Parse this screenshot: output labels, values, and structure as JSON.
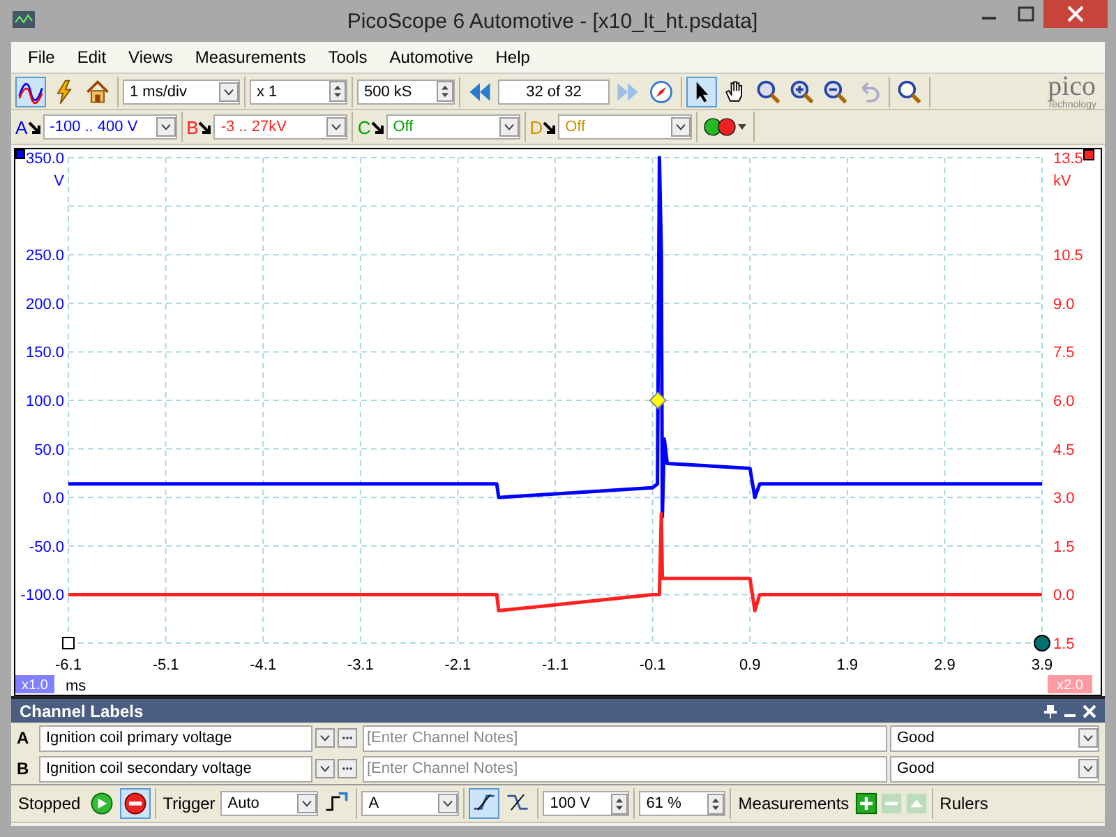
{
  "window": {
    "title": "PicoScope 6 Automotive - [x10_lt_ht.psdata]"
  },
  "menu": [
    "File",
    "Edit",
    "Views",
    "Measurements",
    "Tools",
    "Automotive",
    "Help"
  ],
  "toolbar": {
    "timebase": "1 ms/div",
    "zoom": "x 1",
    "samples": "500 kS",
    "buffer": "32 of 32",
    "logo": "pico",
    "logo_subtitle": "Technology"
  },
  "channels": [
    {
      "letter": "A",
      "range": "-100 .. 400 V",
      "color": "#0000ff"
    },
    {
      "letter": "B",
      "range": "-3 .. 27kV",
      "color": "#ff2020"
    },
    {
      "letter": "C",
      "range": "Off",
      "color": "#00a000"
    },
    {
      "letter": "D",
      "range": "Off",
      "color": "#d09000"
    }
  ],
  "chart": {
    "left_unit": "V",
    "right_unit": "kV",
    "x_unit": "ms",
    "left_scale": "x1.0",
    "right_scale": "x2.0",
    "chart_data": {
      "type": "line",
      "xlim": [
        -6.1,
        3.9
      ],
      "ylim": [
        -150,
        350
      ],
      "xticks": [
        -6.1,
        -5.1,
        -4.1,
        -3.1,
        -2.1,
        -1.1,
        -0.1,
        0.9,
        1.9,
        2.9,
        3.9
      ],
      "yticks": [
        {
          "value": 350,
          "label": "350.0"
        },
        {
          "value": 250,
          "label": "250.0"
        },
        {
          "value": 200,
          "label": "200.0"
        },
        {
          "value": 150,
          "label": "150.0"
        },
        {
          "value": 100,
          "label": "100.0"
        },
        {
          "value": 50,
          "label": "50.0"
        },
        {
          "value": 0,
          "label": "0.0"
        },
        {
          "value": -50,
          "label": "-50.0"
        },
        {
          "value": -100,
          "label": "-100.0"
        }
      ],
      "y2lim": [
        -1.5,
        13.5
      ],
      "y2ticks": [
        {
          "value": 13.5,
          "label": "13.5"
        },
        {
          "value": 10.5,
          "label": "10.5"
        },
        {
          "value": 9,
          "label": "9.0"
        },
        {
          "value": 7.5,
          "label": "7.5"
        },
        {
          "value": 6,
          "label": "6.0"
        },
        {
          "value": 4.5,
          "label": "4.5"
        },
        {
          "value": 3,
          "label": "3.0"
        },
        {
          "value": 1.5,
          "label": "1.5"
        },
        {
          "value": 0,
          "label": "0.0"
        },
        {
          "value": -1.5,
          "label": "1.5"
        }
      ],
      "x": [
        -6.1,
        -1.7,
        -1.68,
        -0.1,
        -0.05,
        -0.03,
        -0.01,
        0.0,
        0.02,
        0.05,
        0.9,
        0.95,
        1.0,
        3.9
      ],
      "series": [
        {
          "color": "#0000ff",
          "values": [
            14,
            14,
            0,
            10,
            14,
            350,
            250,
            -20,
            60,
            35,
            30,
            0,
            14,
            14
          ]
        },
        {
          "color": "#ff2020",
          "axis": "y2",
          "values": [
            0,
            0,
            -0.5,
            0,
            0,
            0,
            2.5,
            0.5,
            0.5,
            0.5,
            0.5,
            -0.5,
            0,
            0
          ]
        }
      ],
      "grid": true
    }
  },
  "channel_labels": {
    "title": "Channel Labels",
    "rows": [
      {
        "channel": "A",
        "label": "Ignition coil primary voltage",
        "notes_placeholder": "[Enter Channel Notes]",
        "status": "Good"
      },
      {
        "channel": "B",
        "label": "Ignition coil secondary voltage",
        "notes_placeholder": "[Enter Channel Notes]",
        "status": "Good"
      }
    ]
  },
  "status_bar": {
    "state": "Stopped",
    "trigger_label": "Trigger",
    "trigger_mode": "Auto",
    "trigger_channel": "A",
    "edges": [
      {
        "kind": "rising",
        "selected": true
      },
      {
        "kind": "falling",
        "selected": false
      }
    ],
    "threshold": "100 V",
    "pre_trigger": "61 %",
    "measurements": "Measurements",
    "rulers": "Rulers"
  }
}
